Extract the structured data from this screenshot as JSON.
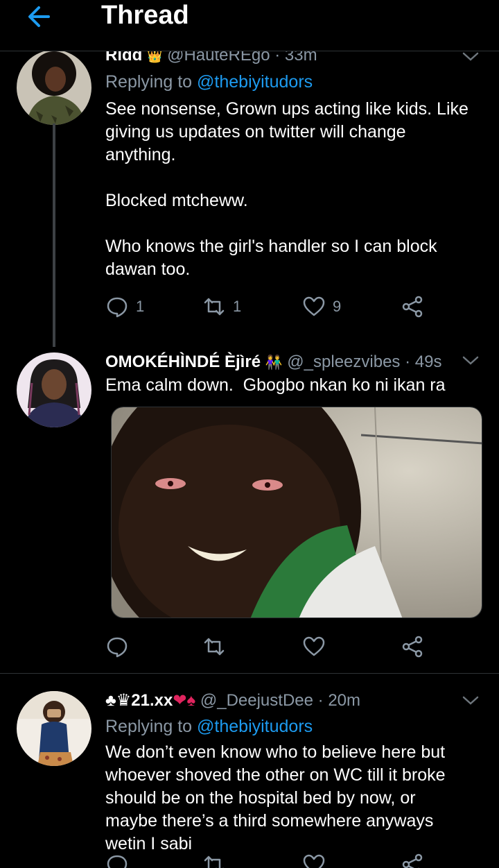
{
  "header": {
    "title": "Thread",
    "back_icon": "arrow-left-icon",
    "accent": "#1d9bf0"
  },
  "tweets": [
    {
      "name": "Ridd",
      "badge": "👑",
      "handle": "@HauteREgo",
      "time": "· 33m",
      "replying_prefix": "Replying to",
      "replying_to": "@thebiyitudors",
      "text": "See nonsense, Grown ups acting like kids. Like giving us updates on twitter will change anything.\n\nBlocked mtcheww.\n\nWho knows the girl's handler so I can block dawan too.",
      "replies": "1",
      "retweets": "1",
      "likes": "9"
    },
    {
      "name": "OMOKÉHÌNDÉ Èjìré",
      "badge": "👫",
      "handle": "@_spleezvibes",
      "time": "· 49s",
      "text": "Ema calm down.  Gbogbo nkan ko ni ikan ra",
      "replies": "",
      "retweets": "",
      "likes": ""
    },
    {
      "name": "♣♛21.xx",
      "badge": "❤♠",
      "handle": "@_DeejustDee",
      "time": "· 20m",
      "replying_prefix": "Replying to",
      "replying_to": "@thebiyitudors",
      "text": "We don’t even know who to believe here but whoever shoved the other on WC till it broke should be on the hospital bed by now, or maybe there’s a third somewhere anyways wetin I sabi"
    }
  ]
}
